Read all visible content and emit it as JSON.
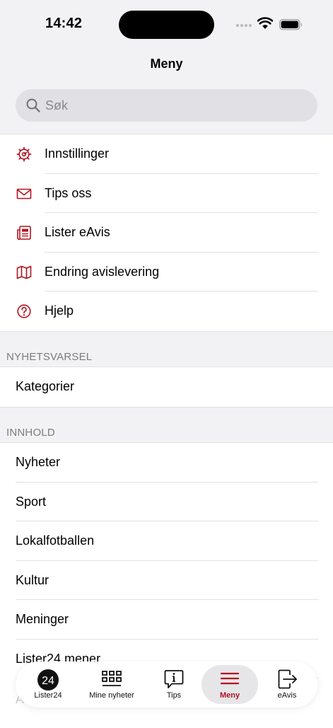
{
  "status_bar": {
    "time": "14:42"
  },
  "header": {
    "title": "Meny"
  },
  "search": {
    "placeholder": "Søk"
  },
  "menu_items": [
    {
      "label": "Innstillinger",
      "icon": "gear-icon"
    },
    {
      "label": "Tips oss",
      "icon": "envelope-icon"
    },
    {
      "label": "Lister eAvis",
      "icon": "newspaper-icon"
    },
    {
      "label": "Endring avislevering",
      "icon": "map-icon"
    },
    {
      "label": "Hjelp",
      "icon": "help-icon"
    }
  ],
  "sections": [
    {
      "header": "NYHETSVARSEL",
      "items": [
        "Kategorier"
      ]
    },
    {
      "header": "INNHOLD",
      "items": [
        "Nyheter",
        "Sport",
        "Lokalfotballen",
        "Kultur",
        "Meninger",
        "Lister24 mener"
      ]
    }
  ],
  "partial_label": "A",
  "tabbar": {
    "tabs": [
      {
        "label": "Lister24",
        "icon": "lister24-logo-icon",
        "active": false
      },
      {
        "label": "Mine nyheter",
        "icon": "grid-icon",
        "active": false
      },
      {
        "label": "Tips",
        "icon": "info-bubble-icon",
        "active": false
      },
      {
        "label": "Meny",
        "icon": "hamburger-menu-icon",
        "active": true
      },
      {
        "label": "eAvis",
        "icon": "exit-icon",
        "active": false
      }
    ]
  },
  "colors": {
    "accent": "#b3121f",
    "background": "#f2f2f4",
    "card": "#ffffff"
  }
}
